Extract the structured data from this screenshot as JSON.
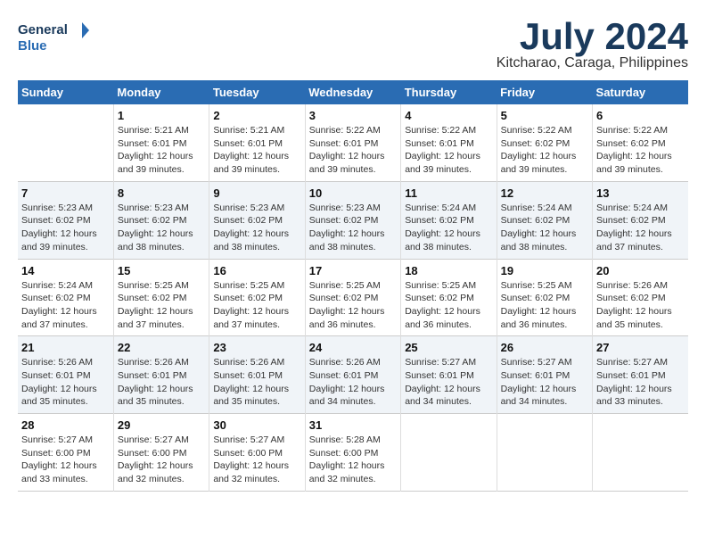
{
  "header": {
    "logo_general": "General",
    "logo_blue": "Blue",
    "month_title": "July 2024",
    "location": "Kitcharao, Caraga, Philippines"
  },
  "calendar": {
    "days_of_week": [
      "Sunday",
      "Monday",
      "Tuesday",
      "Wednesday",
      "Thursday",
      "Friday",
      "Saturday"
    ],
    "weeks": [
      {
        "id": "week1",
        "days": [
          {
            "num": "",
            "info": ""
          },
          {
            "num": "1",
            "info": "Sunrise: 5:21 AM\nSunset: 6:01 PM\nDaylight: 12 hours\nand 39 minutes."
          },
          {
            "num": "2",
            "info": "Sunrise: 5:21 AM\nSunset: 6:01 PM\nDaylight: 12 hours\nand 39 minutes."
          },
          {
            "num": "3",
            "info": "Sunrise: 5:22 AM\nSunset: 6:01 PM\nDaylight: 12 hours\nand 39 minutes."
          },
          {
            "num": "4",
            "info": "Sunrise: 5:22 AM\nSunset: 6:01 PM\nDaylight: 12 hours\nand 39 minutes."
          },
          {
            "num": "5",
            "info": "Sunrise: 5:22 AM\nSunset: 6:02 PM\nDaylight: 12 hours\nand 39 minutes."
          },
          {
            "num": "6",
            "info": "Sunrise: 5:22 AM\nSunset: 6:02 PM\nDaylight: 12 hours\nand 39 minutes."
          }
        ]
      },
      {
        "id": "week2",
        "days": [
          {
            "num": "7",
            "info": "Sunrise: 5:23 AM\nSunset: 6:02 PM\nDaylight: 12 hours\nand 39 minutes."
          },
          {
            "num": "8",
            "info": "Sunrise: 5:23 AM\nSunset: 6:02 PM\nDaylight: 12 hours\nand 38 minutes."
          },
          {
            "num": "9",
            "info": "Sunrise: 5:23 AM\nSunset: 6:02 PM\nDaylight: 12 hours\nand 38 minutes."
          },
          {
            "num": "10",
            "info": "Sunrise: 5:23 AM\nSunset: 6:02 PM\nDaylight: 12 hours\nand 38 minutes."
          },
          {
            "num": "11",
            "info": "Sunrise: 5:24 AM\nSunset: 6:02 PM\nDaylight: 12 hours\nand 38 minutes."
          },
          {
            "num": "12",
            "info": "Sunrise: 5:24 AM\nSunset: 6:02 PM\nDaylight: 12 hours\nand 38 minutes."
          },
          {
            "num": "13",
            "info": "Sunrise: 5:24 AM\nSunset: 6:02 PM\nDaylight: 12 hours\nand 37 minutes."
          }
        ]
      },
      {
        "id": "week3",
        "days": [
          {
            "num": "14",
            "info": "Sunrise: 5:24 AM\nSunset: 6:02 PM\nDaylight: 12 hours\nand 37 minutes."
          },
          {
            "num": "15",
            "info": "Sunrise: 5:25 AM\nSunset: 6:02 PM\nDaylight: 12 hours\nand 37 minutes."
          },
          {
            "num": "16",
            "info": "Sunrise: 5:25 AM\nSunset: 6:02 PM\nDaylight: 12 hours\nand 37 minutes."
          },
          {
            "num": "17",
            "info": "Sunrise: 5:25 AM\nSunset: 6:02 PM\nDaylight: 12 hours\nand 36 minutes."
          },
          {
            "num": "18",
            "info": "Sunrise: 5:25 AM\nSunset: 6:02 PM\nDaylight: 12 hours\nand 36 minutes."
          },
          {
            "num": "19",
            "info": "Sunrise: 5:25 AM\nSunset: 6:02 PM\nDaylight: 12 hours\nand 36 minutes."
          },
          {
            "num": "20",
            "info": "Sunrise: 5:26 AM\nSunset: 6:02 PM\nDaylight: 12 hours\nand 35 minutes."
          }
        ]
      },
      {
        "id": "week4",
        "days": [
          {
            "num": "21",
            "info": "Sunrise: 5:26 AM\nSunset: 6:01 PM\nDaylight: 12 hours\nand 35 minutes."
          },
          {
            "num": "22",
            "info": "Sunrise: 5:26 AM\nSunset: 6:01 PM\nDaylight: 12 hours\nand 35 minutes."
          },
          {
            "num": "23",
            "info": "Sunrise: 5:26 AM\nSunset: 6:01 PM\nDaylight: 12 hours\nand 35 minutes."
          },
          {
            "num": "24",
            "info": "Sunrise: 5:26 AM\nSunset: 6:01 PM\nDaylight: 12 hours\nand 34 minutes."
          },
          {
            "num": "25",
            "info": "Sunrise: 5:27 AM\nSunset: 6:01 PM\nDaylight: 12 hours\nand 34 minutes."
          },
          {
            "num": "26",
            "info": "Sunrise: 5:27 AM\nSunset: 6:01 PM\nDaylight: 12 hours\nand 34 minutes."
          },
          {
            "num": "27",
            "info": "Sunrise: 5:27 AM\nSunset: 6:01 PM\nDaylight: 12 hours\nand 33 minutes."
          }
        ]
      },
      {
        "id": "week5",
        "days": [
          {
            "num": "28",
            "info": "Sunrise: 5:27 AM\nSunset: 6:00 PM\nDaylight: 12 hours\nand 33 minutes."
          },
          {
            "num": "29",
            "info": "Sunrise: 5:27 AM\nSunset: 6:00 PM\nDaylight: 12 hours\nand 32 minutes."
          },
          {
            "num": "30",
            "info": "Sunrise: 5:27 AM\nSunset: 6:00 PM\nDaylight: 12 hours\nand 32 minutes."
          },
          {
            "num": "31",
            "info": "Sunrise: 5:28 AM\nSunset: 6:00 PM\nDaylight: 12 hours\nand 32 minutes."
          },
          {
            "num": "",
            "info": ""
          },
          {
            "num": "",
            "info": ""
          },
          {
            "num": "",
            "info": ""
          }
        ]
      }
    ]
  }
}
